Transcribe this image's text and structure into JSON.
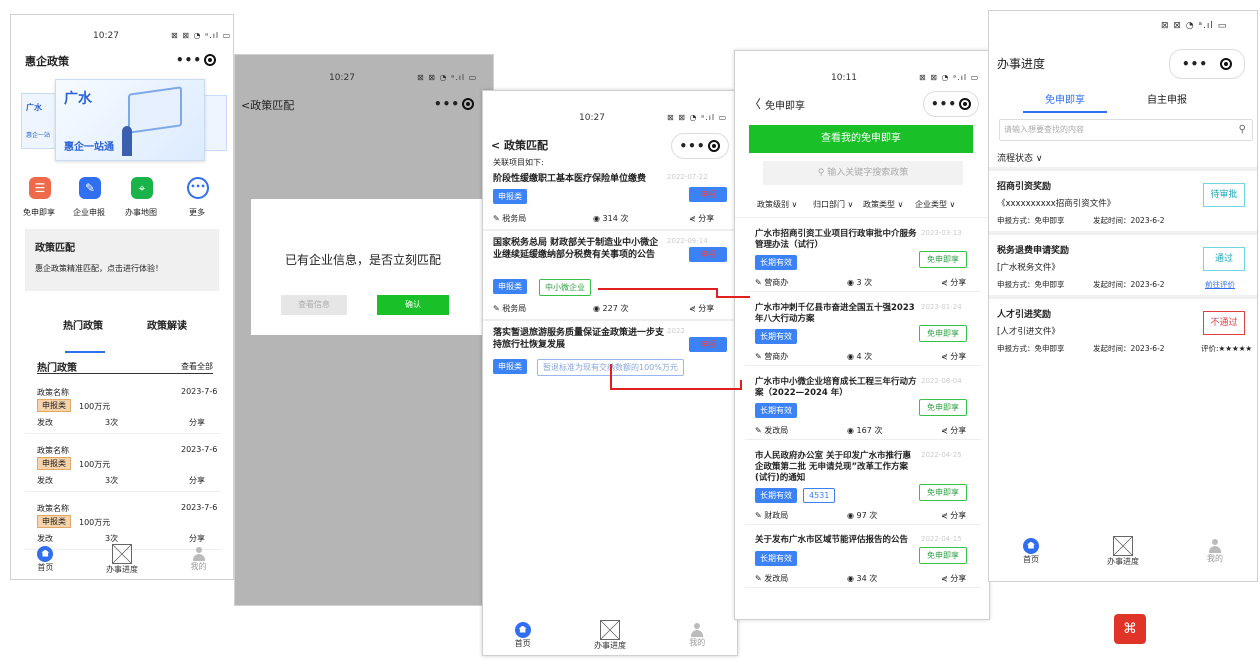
{
  "p1": {
    "time": "10:27",
    "status": "⊠ ⊠ ◔ ᵃ.ıl ▭",
    "title": "惠企政策",
    "banner": {
      "city": "广水",
      "slogan": "惠企一站通",
      "side_left": "广水",
      "side_left_sub": "惠企一站"
    },
    "icons": [
      {
        "label": "免申即享"
      },
      {
        "label": "企业申报"
      },
      {
        "label": "办事地图"
      },
      {
        "label": "更多"
      }
    ],
    "match_box": {
      "title": "政策匹配",
      "desc": "惠企政策精准匹配，点击进行体验！"
    },
    "tabs": [
      "热门政策",
      "政策解读"
    ],
    "hot": {
      "title": "热门政策",
      "all": "查看全部",
      "items": [
        {
          "name": "政策名称",
          "date": "2023-7-6",
          "tag": "申报类",
          "amount": "100万元",
          "dept": "发改",
          "count": "3次",
          "share": "分享"
        },
        {
          "name": "政策名称",
          "date": "2023-7-6",
          "tag": "申报类",
          "amount": "100万元",
          "dept": "发改",
          "count": "3次",
          "share": "分享"
        },
        {
          "name": "政策名称",
          "date": "2023-7-6",
          "tag": "申报类",
          "amount": "100万元",
          "dept": "发改",
          "count": "3次",
          "share": "分享"
        }
      ]
    },
    "tabbar": [
      "首页",
      "办事进度",
      "我的"
    ]
  },
  "p2": {
    "time": "10:27",
    "status": "⊠ ⊠ ◔ ᵃ.ıl ▭",
    "title": "<政策匹配",
    "dialog": {
      "msg": "已有企业信息，是否立刻匹配",
      "cancel": "查看信息",
      "ok": "确认"
    }
  },
  "p3": {
    "time": "10:27",
    "status": "⊠ ⊠ ◔ ᵃ.ıl ▭",
    "title": "< 政策匹配",
    "sub": "关联项目如下:",
    "items": [
      {
        "title": "阶段性缓缴职工基本医疗保险单位缴费",
        "date": "2022-07-22",
        "tag": "申报类",
        "badge": "申报",
        "dept": "税务局",
        "views": "314 次",
        "share": "分享",
        "extra": ""
      },
      {
        "title": "国家税务总局 财政部关于制造业中小微企业继续延缓缴纳部分税费有关事项的公告",
        "date": "2022-09-14",
        "tag": "申报类",
        "badge": "申报",
        "dept": "税务局",
        "views": "227 次",
        "share": "分享",
        "extra": "中小微企业"
      },
      {
        "title": "落实暂退旅游服务质量保证金政策进一步支持旅行社恢复发展",
        "date": "2022",
        "tag": "申报类",
        "badge": "申报",
        "dept": "",
        "views": "",
        "share": "",
        "extra": "暂退标准为现有交纳数额的100%万元"
      }
    ],
    "tabbar": [
      "首页",
      "办事进度",
      "我的"
    ]
  },
  "p4": {
    "time": "10:11",
    "status": "⊠ ⊠ ◔ ᵃ.ıl ▭",
    "title": "免申即享",
    "btn": "查看我的免申即享",
    "search": "输入关键字搜索政策",
    "filters": [
      "政策级别",
      "归口部门",
      "政策类型",
      "企业类型"
    ],
    "items": [
      {
        "title": "广水市招商引资工业项目行政审批中介服务管理办法（试行）",
        "date": "2023-03-13",
        "tag": "长期有效",
        "badge": "免申即享",
        "dept": "营商办",
        "views": "3 次",
        "share": "分享"
      },
      {
        "title": "广水市冲刺千亿县市奋进全国五十强2023 年八大行动方案",
        "date": "2023-01-24",
        "tag": "长期有效",
        "badge": "免申即享",
        "dept": "营商办",
        "views": "4 次",
        "share": "分享"
      },
      {
        "title": "广水市中小微企业培育成长工程三年行动方案（2022—2024 年）",
        "date": "2022-08-04",
        "tag": "长期有效",
        "badge": "免申即享",
        "dept": "发改局",
        "views": "167 次",
        "share": "分享"
      },
      {
        "title": "市人民政府办公室 关于印发广水市推行惠企政策第二批 无申请兑现”改革工作方案(试行)的通知",
        "date": "2022-04-25",
        "tag": "长期有效",
        "tag2": "4531",
        "badge": "免申即享",
        "dept": "财政局",
        "views": "97 次",
        "share": "分享"
      },
      {
        "title": "关于发布广水市区域节能评估报告的公告",
        "date": "2022-04-15",
        "tag": "长期有效",
        "badge": "免申即享",
        "dept": "发改局",
        "views": "34 次",
        "share": "分享"
      }
    ]
  },
  "p5": {
    "status": "⊠ ⊠ ◔ ᵃ.ıl ▭",
    "title": "办事进度",
    "tabs": [
      "免申即享",
      "自主申报"
    ],
    "search": "请输入想要查找的内容",
    "flow": "流程状态 ∨",
    "items": [
      {
        "title": "招商引资奖励",
        "doc": "《xxxxxxxxxx招商引资文件》",
        "way": "申报方式：免申即享",
        "time": "发起时间：2023-6-2",
        "status": "待审批",
        "extra": ""
      },
      {
        "title": "税务退费申请奖励",
        "doc": "[广水税务文件》",
        "way": "申报方式：免申即享",
        "time": "发起时间：2023-6-2",
        "status": "通过",
        "extra": "前往评价"
      },
      {
        "title": "人才引进奖励",
        "doc": "[人才引进文件》",
        "way": "申报方式：免申即享",
        "time": "发起时间：2023-6-2",
        "status": "不通过",
        "extra": "评价:★★★★★"
      }
    ],
    "tabbar": [
      "首页",
      "办事进度",
      "我的"
    ]
  }
}
